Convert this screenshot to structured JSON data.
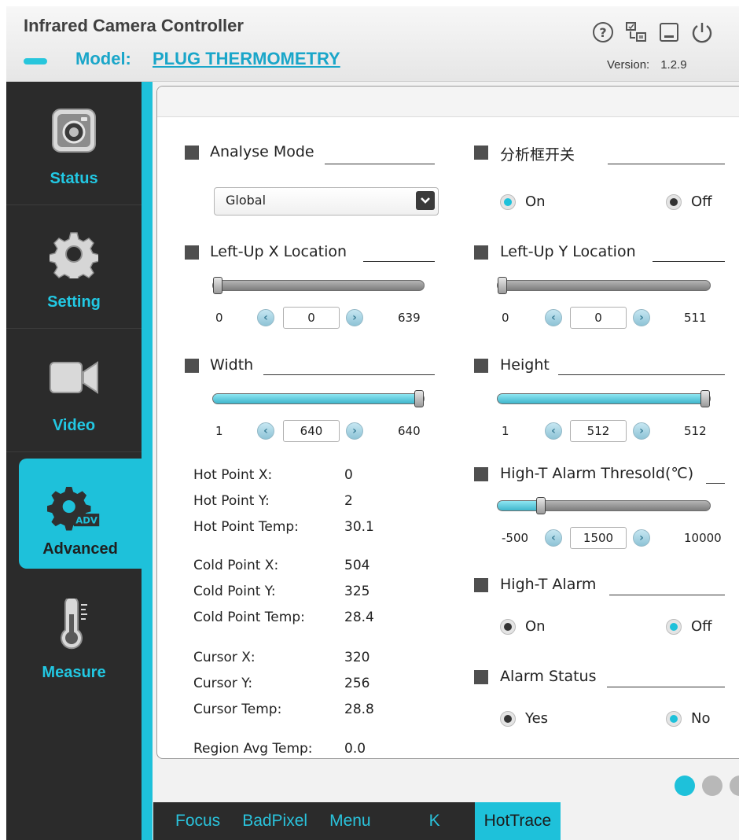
{
  "header": {
    "title": "Infrared Camera Controller",
    "model_label": "Model:",
    "model_value": "PLUG THERMOMETRY",
    "version_label": "Version:",
    "version_value": "1.2.9",
    "icons": [
      "help-icon",
      "device-switch-icon",
      "minimize-icon",
      "power-icon"
    ]
  },
  "sidebar": {
    "items": [
      {
        "label": "Status",
        "icon": "camera-icon"
      },
      {
        "label": "Setting",
        "icon": "gear-icon"
      },
      {
        "label": "Video",
        "icon": "video-camera-icon"
      },
      {
        "label": "Advanced",
        "icon": "gear-adv-icon",
        "badge": "ADV",
        "active": true
      },
      {
        "label": "Measure",
        "icon": "thermometer-icon"
      }
    ]
  },
  "left": {
    "analyse_mode": {
      "label": "Analyse Mode",
      "selected": "Global"
    },
    "left_up_x": {
      "label": "Left-Up X Location",
      "min": "0",
      "value": "0",
      "max": "639",
      "fraction": 0.0
    },
    "width": {
      "label": "Width",
      "min": "1",
      "value": "640",
      "max": "640",
      "fraction": 1.0
    },
    "hot": [
      {
        "label": "Hot Point X:",
        "value": "0"
      },
      {
        "label": "Hot Point Y:",
        "value": "2"
      },
      {
        "label": "Hot Point Temp:",
        "value": "30.1"
      }
    ],
    "cold": [
      {
        "label": "Cold Point X:",
        "value": "504"
      },
      {
        "label": "Cold Point Y:",
        "value": "325"
      },
      {
        "label": "Cold Point Temp:",
        "value": "28.4"
      }
    ],
    "cursor": [
      {
        "label": "Cursor X:",
        "value": "320"
      },
      {
        "label": "Cursor Y:",
        "value": "256"
      },
      {
        "label": "Cursor Temp:",
        "value": "28.8"
      }
    ],
    "region": {
      "label": "Region Avg Temp:",
      "value": "0.0"
    }
  },
  "right": {
    "analysis_box": {
      "label": "分析框开关",
      "on": "On",
      "off": "Off",
      "selected": "On"
    },
    "left_up_y": {
      "label": "Left-Up Y Location",
      "min": "0",
      "value": "0",
      "max": "511",
      "fraction": 0.0
    },
    "height": {
      "label": "Height",
      "min": "1",
      "value": "512",
      "max": "512",
      "fraction": 1.0
    },
    "high_t_threshold": {
      "label": "High-T Alarm Thresold(℃)",
      "min": "-500",
      "value": "1500",
      "max": "10000",
      "fraction": 0.19
    },
    "high_t_alarm": {
      "label": "High-T Alarm",
      "on": "On",
      "off": "Off",
      "selected": "Off"
    },
    "alarm_status": {
      "label": "Alarm Status",
      "yes": "Yes",
      "no": "No",
      "selected": "No"
    }
  },
  "pager": {
    "count": 3,
    "active": 0
  },
  "tabs": [
    {
      "label": "Focus"
    },
    {
      "label": "BadPixel"
    },
    {
      "label": "Menu"
    },
    {
      "label": "K"
    },
    {
      "label": "HotTrace",
      "active": true
    }
  ],
  "colors": {
    "accent": "#1ec1da",
    "sidebar": "#2b2b2b",
    "link": "#1aa6c9"
  }
}
